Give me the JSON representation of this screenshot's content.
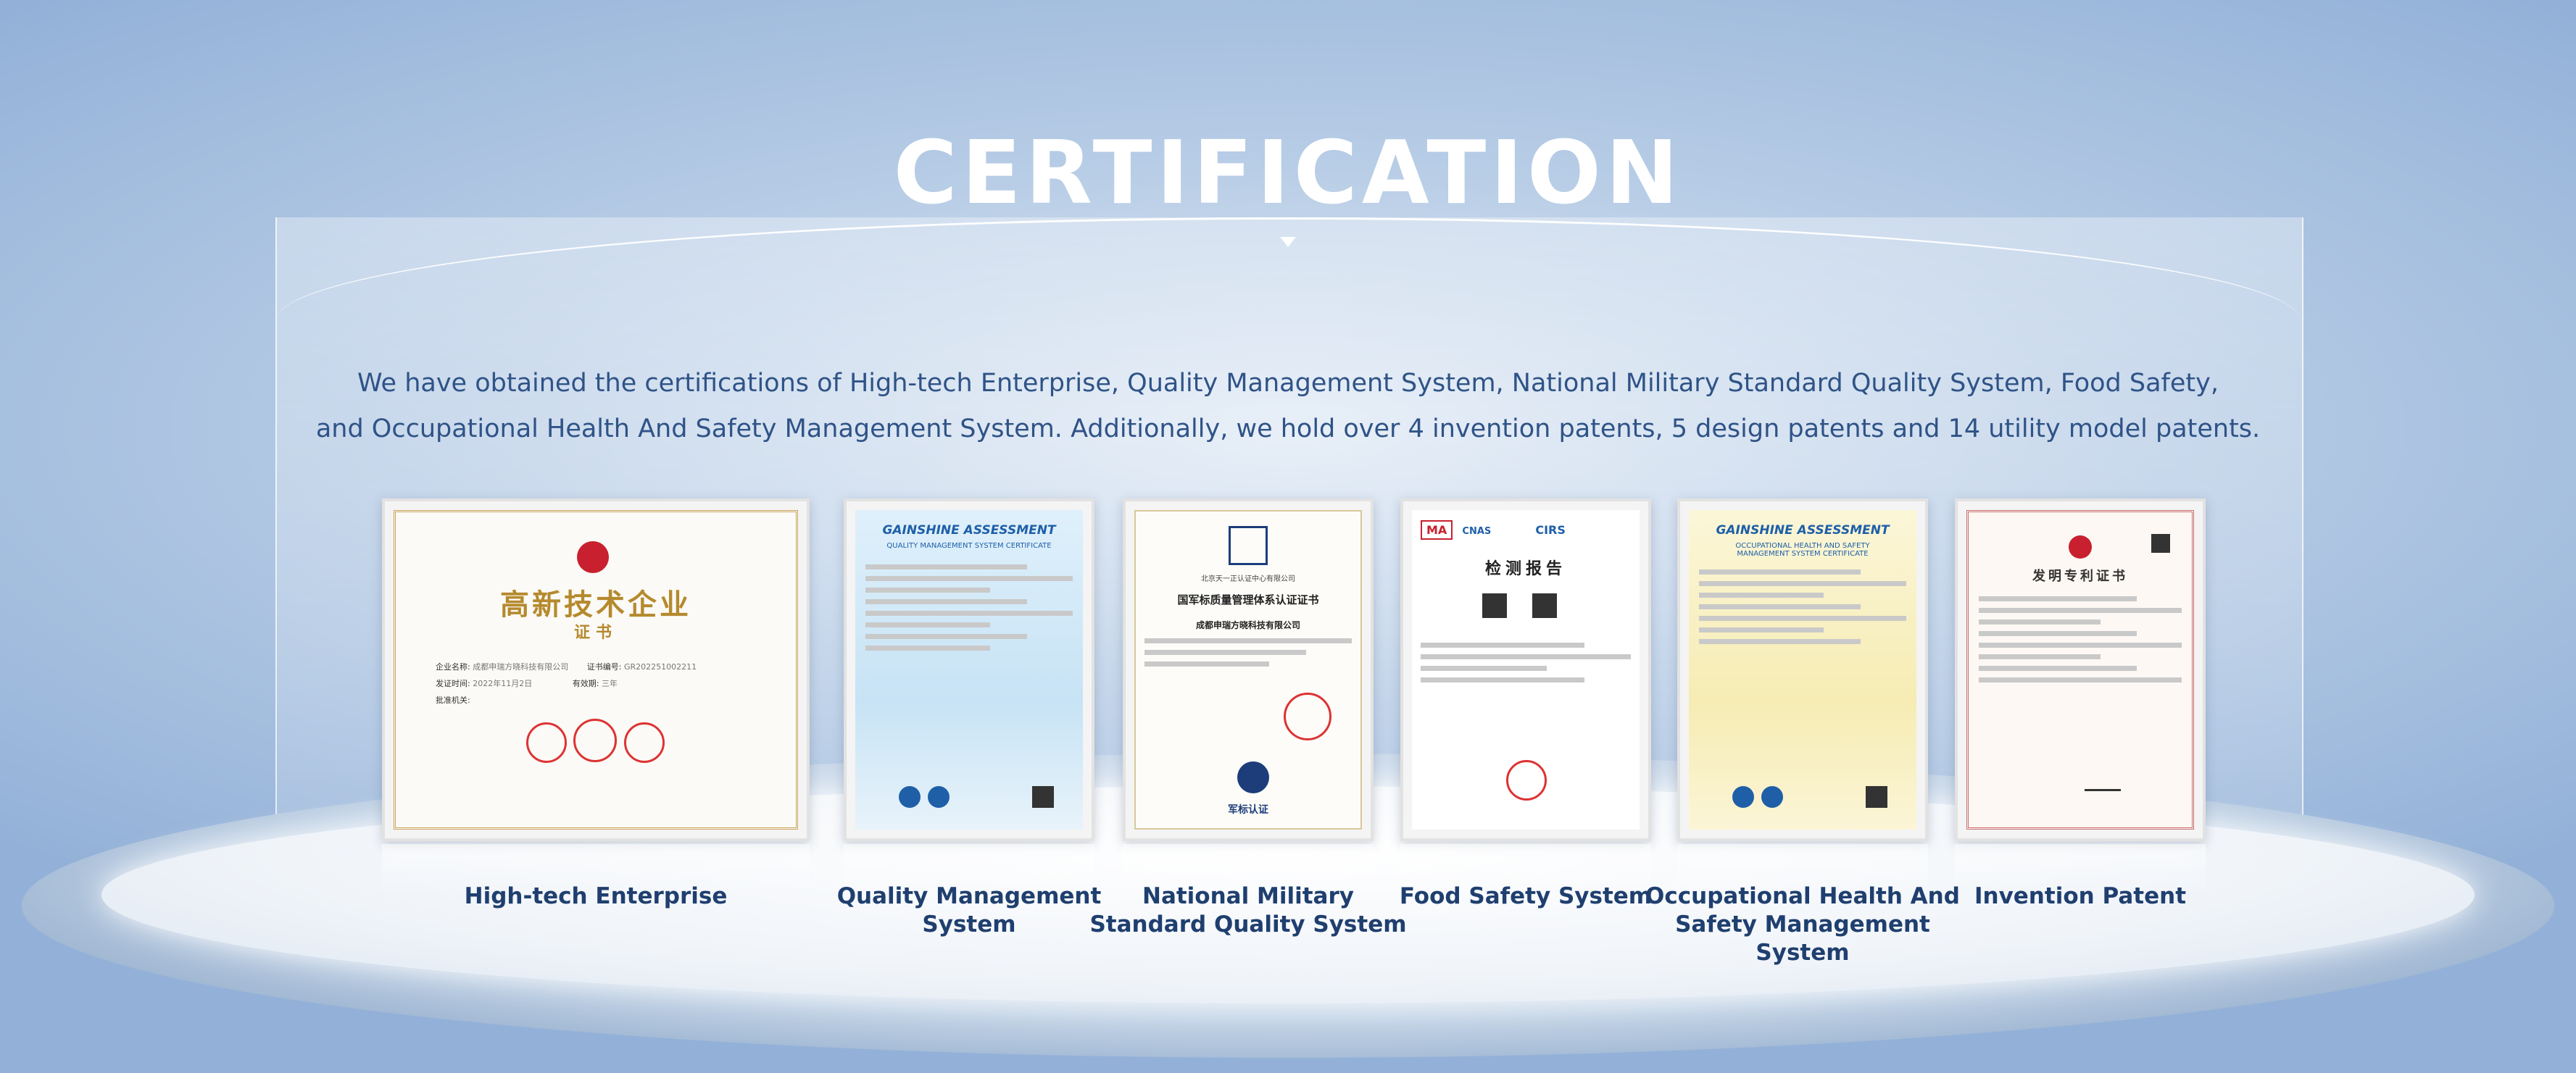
{
  "title": "CERTIFICATION",
  "intro_line1": "We have obtained the certifications of High-tech Enterprise, Quality Management System, National Military Standard Quality System, Food Safety,",
  "intro_line2": "and Occupational Health And Safety Management System. Additionally, we hold over 4 invention patents, 5 design patents and 14 utility model patents.",
  "certificates": [
    {
      "label_lines": [
        "High-tech Enterprise"
      ],
      "image_text": {
        "title": "高新技术企业",
        "subtitle": "证书",
        "row1_label": "企业名称:",
        "row1_value": "成都申瑞方晓科技有限公司",
        "row1b_label": "证书编号:",
        "row1b_value": "GR202251002211",
        "row2_label": "发证时间:",
        "row2_value": "2022年11月2日",
        "row2b_label": "有效期:",
        "row2b_value": "三年",
        "row3_label": "批准机关:"
      }
    },
    {
      "label_lines": [
        "Quality Management",
        "System"
      ],
      "image_text": {
        "brand": "GAINSHINE ASSESSMENT",
        "heading": "QUALITY MANAGEMENT SYSTEM CERTIFICATE"
      }
    },
    {
      "label_lines": [
        "National Military",
        "Standard Quality System"
      ],
      "image_text": {
        "issuer": "北京天一正认证中心有限公司",
        "heading": "国军标质量管理体系认证证书",
        "company": "成都申瑞方晓科技有限公司",
        "mark": "军标认证"
      }
    },
    {
      "label_lines": [
        "Food Safety System"
      ],
      "image_text": {
        "logo_ma": "MA",
        "logo_cnas": "CNAS",
        "logo_cirs": "CIRS",
        "heading": "检测报告"
      }
    },
    {
      "label_lines": [
        "Occupational Health And",
        "Safety Management System"
      ],
      "image_text": {
        "brand": "GAINSHINE ASSESSMENT",
        "heading_1": "OCCUPATIONAL HEALTH AND SAFETY",
        "heading_2": "MANAGEMENT SYSTEM CERTIFICATE"
      }
    },
    {
      "label_lines": [
        "Invention Patent"
      ],
      "image_text": {
        "heading": "发明专利证书"
      }
    }
  ],
  "colors": {
    "title": "#ffffff",
    "intro_text": "#2f5387",
    "label_text": "#1f3f6f",
    "background": "#93b1d8",
    "stage": "#f3f7fb"
  }
}
